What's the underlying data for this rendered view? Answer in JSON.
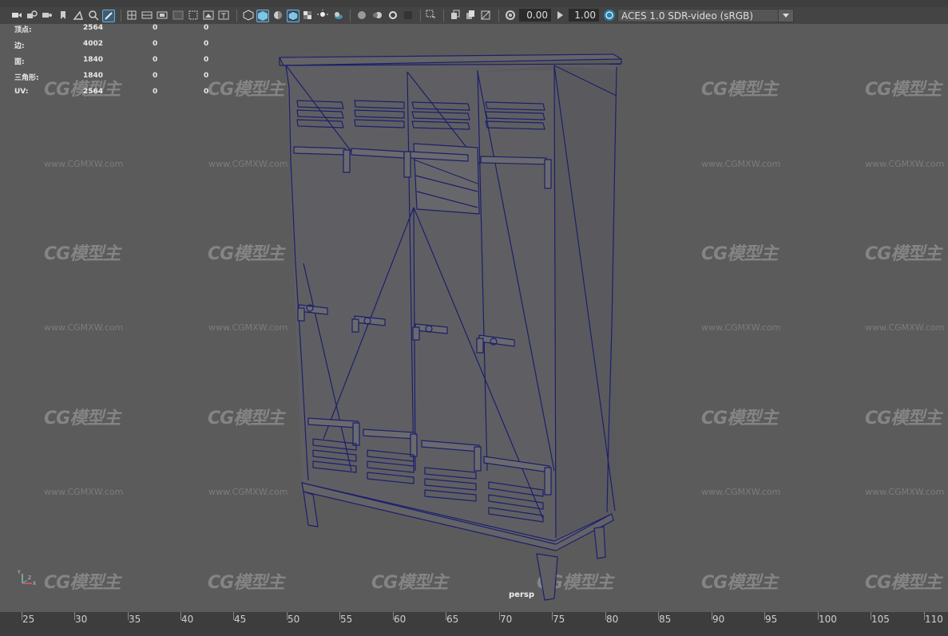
{
  "menu": [
    "",
    "",
    "",
    "",
    "",
    ""
  ],
  "toolbar": {
    "exposure": "0.00",
    "gamma": "1.00",
    "color_space": "ACES 1.0 SDR-video (sRGB)"
  },
  "hud": {
    "rows": [
      {
        "label": "顶点:",
        "v1": "2564",
        "v2": "0",
        "v3": "0"
      },
      {
        "label": "边:",
        "v1": "4002",
        "v2": "0",
        "v3": "0"
      },
      {
        "label": "面:",
        "v1": "1840",
        "v2": "0",
        "v3": "0"
      },
      {
        "label": "三角形:",
        "v1": "1840",
        "v2": "0",
        "v3": "0"
      },
      {
        "label": "UV:",
        "v1": "2564",
        "v2": "0",
        "v3": "0"
      }
    ]
  },
  "viewport": {
    "camera": "persp",
    "watermark_logo": "CG模型主",
    "watermark_url": "www.CGMXW.com",
    "axis": {
      "y": "Y",
      "x": "X",
      "z": "Z"
    }
  },
  "timeline": {
    "ticks": [
      "25",
      "30",
      "35",
      "40",
      "45",
      "50",
      "55",
      "60",
      "65",
      "70",
      "75",
      "80",
      "85",
      "90",
      "95",
      "100",
      "105",
      "110"
    ]
  }
}
